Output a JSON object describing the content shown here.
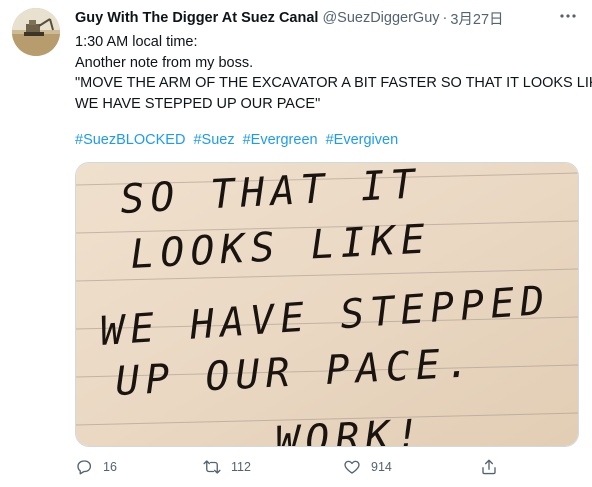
{
  "tweet": {
    "display_name": "Guy With The Digger At Suez Canal",
    "handle": "@SuezDiggerGuy",
    "separator": "·",
    "date": "3月27日",
    "lines": [
      "1:30 AM local time:",
      "Another note from my boss.",
      "\"MOVE THE ARM OF THE EXCAVATOR A BIT FASTER SO THAT IT LOOKS LIKE",
      "WE HAVE STEPPED UP OUR PACE\""
    ],
    "hashtags": [
      "#SuezBLOCKED",
      "#Suez",
      "#Evergreen",
      "#Evergiven"
    ]
  },
  "media": {
    "handwritten_lines": [
      "SO THAT IT",
      "LOOKS LIKE",
      "WE HAVE STEPPED",
      "UP OUR PACE.",
      "WORK!"
    ]
  },
  "actions": {
    "reply_count": "16",
    "retweet_count": "112",
    "like_count": "914"
  },
  "colors": {
    "accent": "#1d9bf0",
    "muted": "#536471",
    "paper": "#ead8c3",
    "ink": "#1a1410"
  }
}
